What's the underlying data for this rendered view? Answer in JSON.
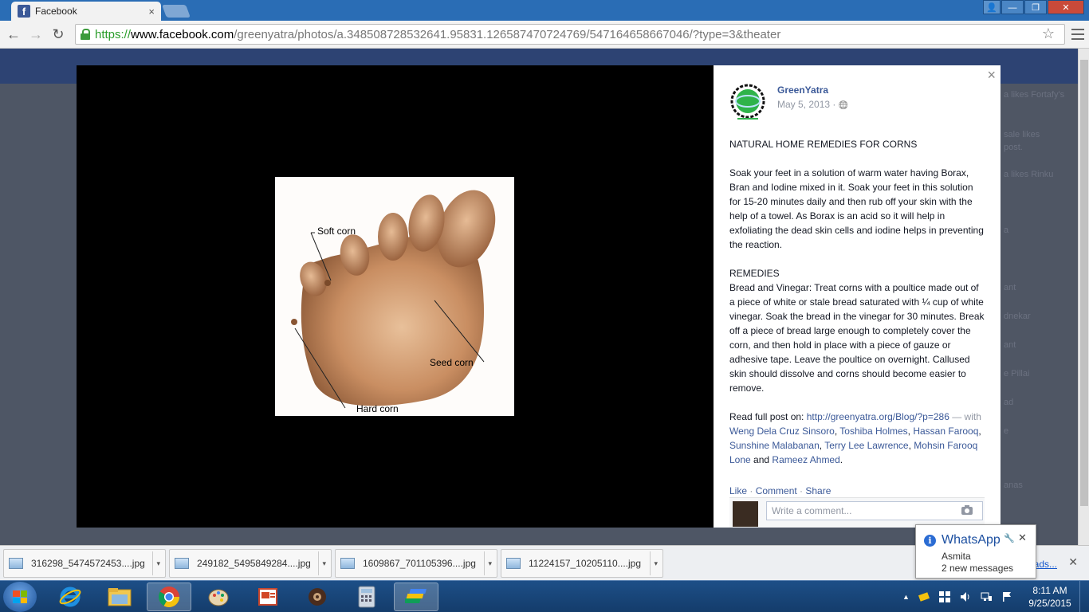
{
  "browser": {
    "tab_title": "Facebook",
    "tab_close": "×",
    "url_proto": "https://",
    "url_host": "www.facebook.com",
    "url_path": "/greenyatra/photos/a.348508728532641.95831.126587470724769/547164658667046/?type=3&theater",
    "back_icon": "←",
    "forward_icon": "→",
    "reload_icon": "↻",
    "star_icon": "☆"
  },
  "window_controls": {
    "user": "👤",
    "minimize": "—",
    "maximize": "❐",
    "close": "✕"
  },
  "photo": {
    "labels": {
      "soft_corn": "Soft corn",
      "seed_corn": "Seed corn",
      "hard_corn": "Hard corn"
    }
  },
  "post": {
    "close": "×",
    "page_name": "GreenYatra",
    "date": "May 5, 2013 · ",
    "globe_icon": "🌐",
    "title": "NATURAL HOME REMEDIES FOR CORNS",
    "paragraph1": "Soak your feet in a solution of warm water having Borax, Bran and Iodine mixed in it. Soak your feet in this solution for 15-20 minutes daily and then rub off your skin with the help of a towel. As Borax is an acid so it will help in exfoliating the dead skin cells and iodine helps in preventing the reaction.",
    "remedies_heading": "REMEDIES",
    "paragraph2": "Bread and Vinegar: Treat corns with a poultice made out of a piece of white or stale bread saturated with ¼ cup of white vinegar. Soak the bread in the vinegar for 30 minutes. Break off a piece of bread large enough to completely cover the corn, and then hold in place with a piece of gauze or adhesive tape. Leave the poultice on overnight. Callused skin should dissolve and corns should become easier to remove.",
    "read_full": "Read full post on: ",
    "read_full_link": "http://greenyatra.org/Blog/?p=286",
    "with_text": " — with ",
    "tagged": [
      "Weng Dela Cruz Sinsoro",
      "Toshiba Holmes",
      "Hassan Farooq",
      "Sunshine Malabanan",
      "Terry Lee Lawrence",
      "Mohsin Farooq Lone",
      "Rameez Ahmed"
    ],
    "comma": ", ",
    "and_text": " and ",
    "period": ".",
    "actions": {
      "like": "Like",
      "comment": "Comment",
      "share": "Share",
      "sep": " · "
    },
    "comment_placeholder": "Write a comment..."
  },
  "downloads": {
    "items": [
      {
        "name": "316298_5474572453....jpg"
      },
      {
        "name": "249182_5495849284....jpg"
      },
      {
        "name": "1609867_701105396....jpg"
      },
      {
        "name": "11224157_10205110....jpg"
      }
    ],
    "caret": "▾",
    "show_all": "ads...",
    "close": "✕"
  },
  "toast": {
    "info": "i",
    "title": "WhatsApp",
    "line1": "Asmita",
    "line2": "2 new messages",
    "gear": "🔧",
    "close": "✕"
  },
  "taskbar": {
    "apps": [
      "internet-explorer",
      "file-explorer",
      "chrome",
      "paint",
      "presentation",
      "media",
      "calculator",
      "bluestacks"
    ],
    "clock_time": "8:11 AM",
    "clock_date": "9/25/2015",
    "tray_arrow": "▲",
    "colors": {
      "ie": "#1e8fe0",
      "explorer": "#f0c850",
      "chrome_red": "#db4437",
      "chrome_yellow": "#f4c20d",
      "chrome_green": "#0f9d58",
      "chrome_blue": "#4285f4"
    }
  },
  "fb_background": {
    "side_rows": [
      "a likes Fortafy's",
      "sale likes",
      "post.",
      "a likes Rinku",
      "",
      "a",
      "ant",
      "dnekar",
      "ant",
      "e Pillai",
      "ad",
      "e",
      "",
      "anas"
    ]
  }
}
